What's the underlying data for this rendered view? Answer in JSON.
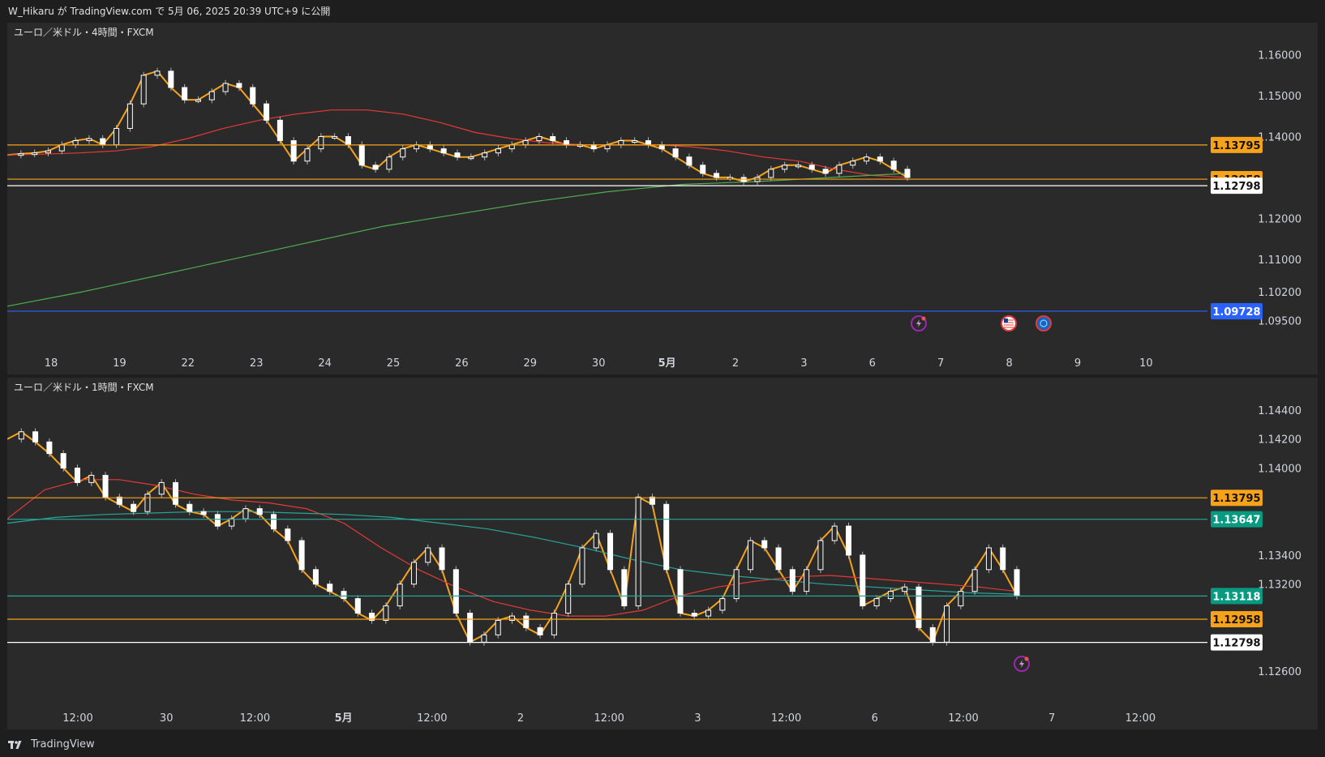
{
  "header": {
    "text": "W_Hikaru が TradingView.com で 5月 06, 2025 20:39 UTC+9 に公開"
  },
  "footer": {
    "brand": "TradingView"
  },
  "icons": [
    "lightning-event-icon",
    "us-flag-icon",
    "globe-event-icon"
  ],
  "colors": {
    "panel_bg": "#2a2a2a",
    "orange": "#f7a21b",
    "red_ma": "#e53935",
    "green_ma": "#4caf50",
    "teal_ma": "#26a69a",
    "blue_line": "#2962ff",
    "white": "#ffffff",
    "label_orange": "#f7a21b",
    "label_teal": "#089981",
    "label_blue": "#2962ff"
  },
  "chart_data": [
    {
      "type": "candlestick",
      "title": "ユーロ／米ドル・4時間・FXCM",
      "timeframe": "4時間",
      "x_labels": [
        "18",
        "19",
        "22",
        "23",
        "24",
        "25",
        "26",
        "29",
        "30",
        "5月",
        "2",
        "3",
        "6",
        "7",
        "8",
        "9",
        "10"
      ],
      "y_ticks": [
        "1.16000",
        "1.15000",
        "1.14000",
        "1.12000",
        "1.11000",
        "1.10200",
        "1.09500"
      ],
      "ylim": [
        1.0935,
        1.1635
      ],
      "levels": [
        {
          "value": 1.13795,
          "label": "1.13795",
          "color": "orange"
        },
        {
          "value": 1.12958,
          "label": "1.12958",
          "color": "orange"
        },
        {
          "value": 1.12798,
          "label": "1.12798",
          "color": "white"
        },
        {
          "value": 1.09728,
          "label": "1.09728",
          "color": "blue"
        }
      ],
      "series": [
        {
          "name": "",
          "kind": "close_trace",
          "color": "orange",
          "values": [
            1.1355,
            1.1358,
            1.136,
            1.1365,
            1.138,
            1.139,
            1.1395,
            1.138,
            1.142,
            1.148,
            1.155,
            1.156,
            1.152,
            1.149,
            1.149,
            1.151,
            1.153,
            1.152,
            1.148,
            1.144,
            1.139,
            1.134,
            1.137,
            1.14,
            1.14,
            1.138,
            1.133,
            1.132,
            1.135,
            1.137,
            1.138,
            1.137,
            1.136,
            1.135,
            1.135,
            1.136,
            1.137,
            1.138,
            1.139,
            1.14,
            1.139,
            1.138,
            1.138,
            1.137,
            1.138,
            1.139,
            1.139,
            1.138,
            1.137,
            1.135,
            1.133,
            1.131,
            1.13,
            1.13,
            1.129,
            1.13,
            1.132,
            1.133,
            1.133,
            1.132,
            1.131,
            1.133,
            1.134,
            1.135,
            1.134,
            1.132,
            1.13
          ]
        },
        {
          "name": "",
          "kind": "ma_short",
          "color": "red",
          "values": [
            1.1355,
            1.1357,
            1.136,
            1.1365,
            1.1375,
            1.1395,
            1.142,
            1.144,
            1.1455,
            1.1465,
            1.1465,
            1.1455,
            1.1435,
            1.141,
            1.1395,
            1.1385,
            1.138,
            1.138,
            1.138,
            1.1375,
            1.1365,
            1.135,
            1.134,
            1.132,
            1.1305,
            1.13
          ]
        },
        {
          "name": "",
          "kind": "ma_long",
          "color": "green",
          "values": [
            1.0985,
            1.102,
            1.106,
            1.11,
            1.114,
            1.118,
            1.121,
            1.124,
            1.1265,
            1.1283,
            1.129,
            1.13,
            1.131
          ]
        }
      ],
      "event_markers": [
        "lightning-event-icon",
        "us-flag-icon",
        "globe-event-icon"
      ]
    },
    {
      "type": "candlestick",
      "title": "ユーロ／米ドル・1時間・FXCM",
      "timeframe": "1時間",
      "x_labels": [
        "12:00",
        "30",
        "12:00",
        "5月",
        "12:00",
        "2",
        "12:00",
        "3",
        "12:00",
        "6",
        "12:00",
        "7",
        "12:00"
      ],
      "y_ticks": [
        "1.14400",
        "1.14200",
        "1.14000",
        "1.13400",
        "1.13200",
        "1.12600"
      ],
      "ylim": [
        1.125,
        1.145
      ],
      "levels": [
        {
          "value": 1.13795,
          "label": "1.13795",
          "color": "orange"
        },
        {
          "value": 1.13647,
          "label": "1.13647",
          "color": "teal"
        },
        {
          "value": 1.13118,
          "label": "1.13118",
          "color": "teal"
        },
        {
          "value": 1.12958,
          "label": "1.12958",
          "color": "orange"
        },
        {
          "value": 1.12798,
          "label": "1.12798",
          "color": "white"
        }
      ],
      "series": [
        {
          "name": "",
          "kind": "close_trace",
          "color": "orange",
          "values": [
            1.142,
            1.1425,
            1.1418,
            1.141,
            1.14,
            1.139,
            1.1395,
            1.138,
            1.1375,
            1.137,
            1.1382,
            1.139,
            1.1375,
            1.137,
            1.1368,
            1.136,
            1.1365,
            1.1372,
            1.1368,
            1.1358,
            1.135,
            1.133,
            1.132,
            1.1315,
            1.131,
            1.13,
            1.1295,
            1.1305,
            1.132,
            1.1335,
            1.1345,
            1.133,
            1.13,
            1.128,
            1.1285,
            1.1295,
            1.1298,
            1.129,
            1.1285,
            1.13,
            1.132,
            1.1345,
            1.1355,
            1.133,
            1.1305,
            1.138,
            1.1375,
            1.133,
            1.13,
            1.1298,
            1.1302,
            1.131,
            1.133,
            1.135,
            1.1345,
            1.133,
            1.1315,
            1.133,
            1.135,
            1.136,
            1.134,
            1.1305,
            1.131,
            1.1315,
            1.1318,
            1.129,
            1.128,
            1.1305,
            1.1315,
            1.133,
            1.1345,
            1.133,
            1.1312
          ]
        },
        {
          "name": "",
          "kind": "ma_short",
          "color": "red",
          "values": [
            1.1365,
            1.1385,
            1.1392,
            1.1392,
            1.1388,
            1.1382,
            1.1378,
            1.1376,
            1.1372,
            1.1362,
            1.1345,
            1.133,
            1.1318,
            1.1308,
            1.1302,
            1.1298,
            1.1298,
            1.1302,
            1.1312,
            1.1318,
            1.1322,
            1.1325,
            1.1326,
            1.1324,
            1.1322,
            1.132,
            1.1318,
            1.1315
          ]
        },
        {
          "name": "",
          "kind": "ma_long",
          "color": "teal",
          "values": [
            1.1362,
            1.1366,
            1.1368,
            1.1369,
            1.137,
            1.137,
            1.1369,
            1.1368,
            1.1366,
            1.1362,
            1.1358,
            1.1352,
            1.1345,
            1.1337,
            1.133,
            1.1326,
            1.1323,
            1.132,
            1.1318,
            1.1316,
            1.1314,
            1.1313
          ]
        }
      ],
      "event_markers": [
        "lightning-event-icon"
      ]
    }
  ]
}
